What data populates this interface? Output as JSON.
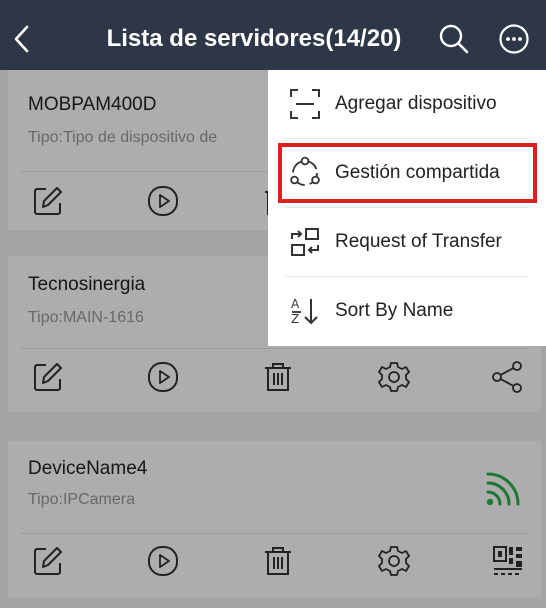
{
  "header": {
    "title": "Lista de servidores(14/20)",
    "back_icon": "chevron-left-icon",
    "search_icon": "search-icon",
    "more_icon": "more-circle-icon",
    "background": "#2d3748"
  },
  "devices": [
    {
      "name": "MOBPAM400D",
      "type": "Tipo:Tipo de dispositivo de"
    },
    {
      "name": "Tecnosinergia",
      "type": "Tipo:MAIN-1616"
    },
    {
      "name": "DeviceName4",
      "type": "Tipo:IPCamera",
      "status_icon": "wifi-signal-icon",
      "status_color": "#2bb24c"
    }
  ],
  "menu": {
    "items": [
      {
        "label": "Agregar dispositivo",
        "icon": "scan-icon"
      },
      {
        "label": "Gestión compartida",
        "icon": "share-manage-icon"
      },
      {
        "label": "Request of Transfer",
        "icon": "transfer-icon"
      },
      {
        "label": "Sort By Name",
        "icon": "sort-az-icon"
      }
    ],
    "highlight_color": "#e01f1f"
  }
}
